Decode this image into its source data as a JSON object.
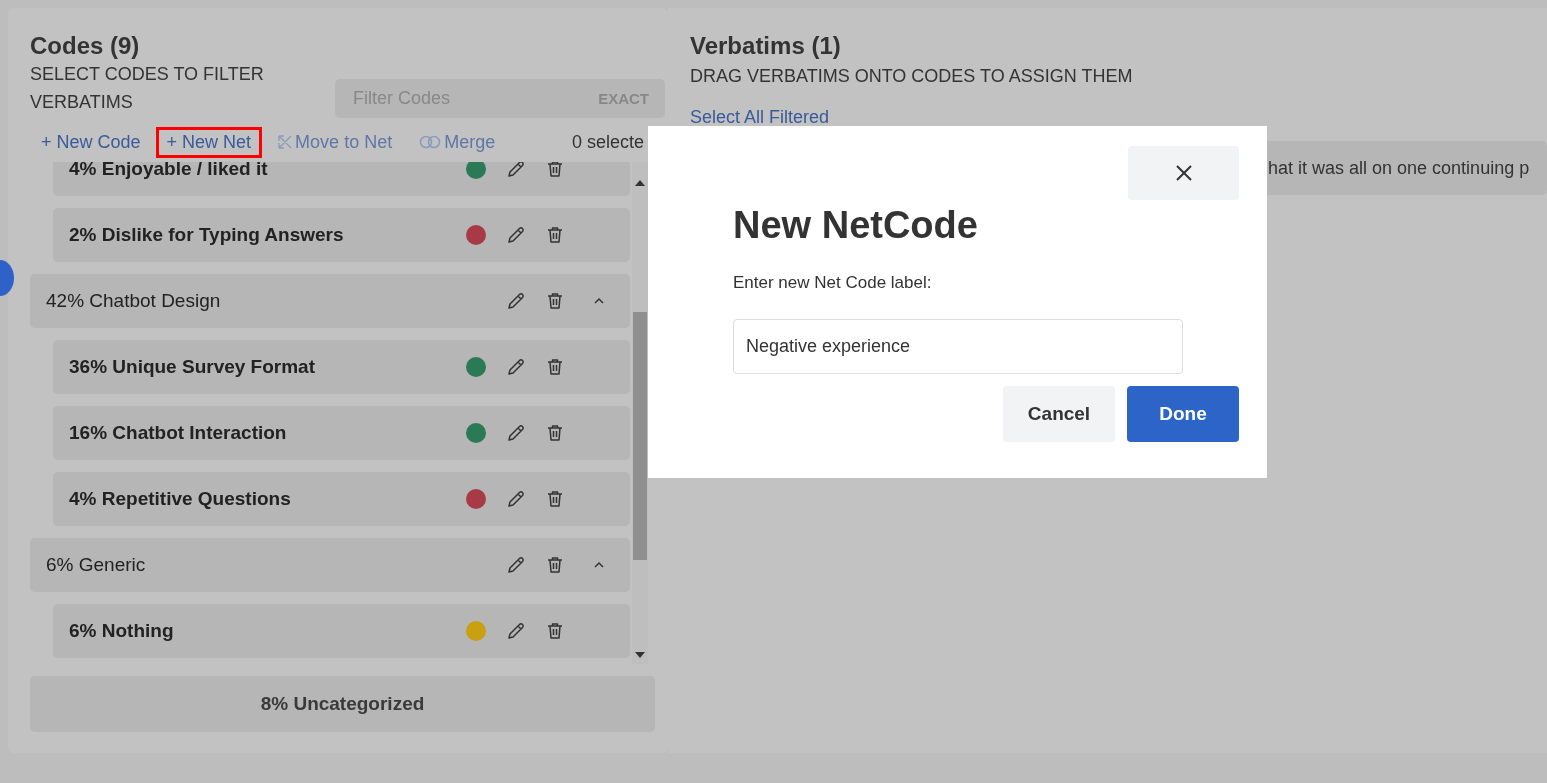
{
  "codes_panel": {
    "title": "Codes (9)",
    "subtitle": "SELECT CODES TO FILTER VERBATIMS",
    "filter": {
      "placeholder": "Filter Codes",
      "exact_label": "EXACT",
      "exact_on": false
    },
    "toolbar": [
      {
        "kind": "new",
        "label": "+ New Code",
        "disabled": false,
        "highlighted": false
      },
      {
        "kind": "new",
        "label": "+ New Net",
        "disabled": false,
        "highlighted": true
      },
      {
        "kind": "move",
        "label": "Move to Net",
        "disabled": true,
        "highlighted": false
      },
      {
        "kind": "merge",
        "label": "Merge",
        "disabled": true,
        "highlighted": false
      }
    ],
    "selected_count": "0 selecte",
    "tree": [
      {
        "kind": "code",
        "label": "4% Enjoyable / liked it",
        "color": "#2a7a55"
      },
      {
        "kind": "code",
        "label": "2% Dislike for Typing Answers",
        "color": "#a83a45"
      },
      {
        "kind": "net",
        "label": "42% Chatbot Design",
        "expanded": true,
        "children": [
          {
            "kind": "code",
            "label": "36% Unique Survey Format",
            "color": "#2a7a55"
          },
          {
            "kind": "code",
            "label": "16% Chatbot Interaction",
            "color": "#2a7a55"
          },
          {
            "kind": "code",
            "label": "4% Repetitive Questions",
            "color": "#a83a45"
          }
        ]
      },
      {
        "kind": "net",
        "label": "6% Generic",
        "expanded": true,
        "children": [
          {
            "kind": "code",
            "label": "6% Nothing",
            "color": "#c9a010"
          }
        ]
      }
    ],
    "uncategorized": "8% Uncategorized"
  },
  "verbatims_panel": {
    "title": "Verbatims (1)",
    "subtitle": "DRAG VERBATIMS ONTO CODES TO ASSIGN THEM",
    "select_all": "Select All Filtered",
    "verbatims": [
      "hat it was all on one continuing p"
    ]
  },
  "dialog": {
    "title": "New NetCode",
    "field_label": "Enter new Net Code label:",
    "value": "Negative experience",
    "buttons": [
      {
        "kind": "secondary",
        "label": "Cancel"
      },
      {
        "kind": "primary",
        "label": "Done"
      }
    ]
  }
}
